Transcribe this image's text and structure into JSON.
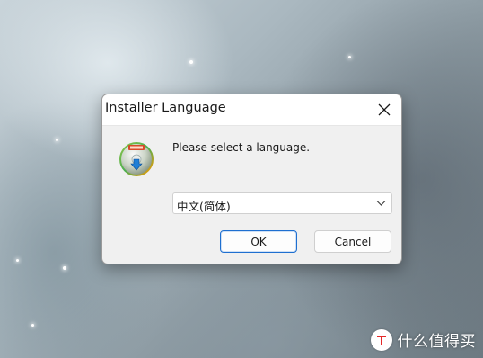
{
  "dialog": {
    "title": "Installer Language",
    "prompt": "Please select a language.",
    "selected_language": "中文(简体)",
    "ok_label": "OK",
    "cancel_label": "Cancel"
  },
  "icons": {
    "close": "close-icon",
    "installer": "installer-icon",
    "dropdown": "chevron-down-icon",
    "watermark": "smzdm-logo-icon"
  },
  "watermark": {
    "text": "什么值得买"
  },
  "colors": {
    "accent": "#1e6fd0",
    "dialog_bg": "#f0f0f0",
    "titlebar_bg": "#ffffff"
  }
}
